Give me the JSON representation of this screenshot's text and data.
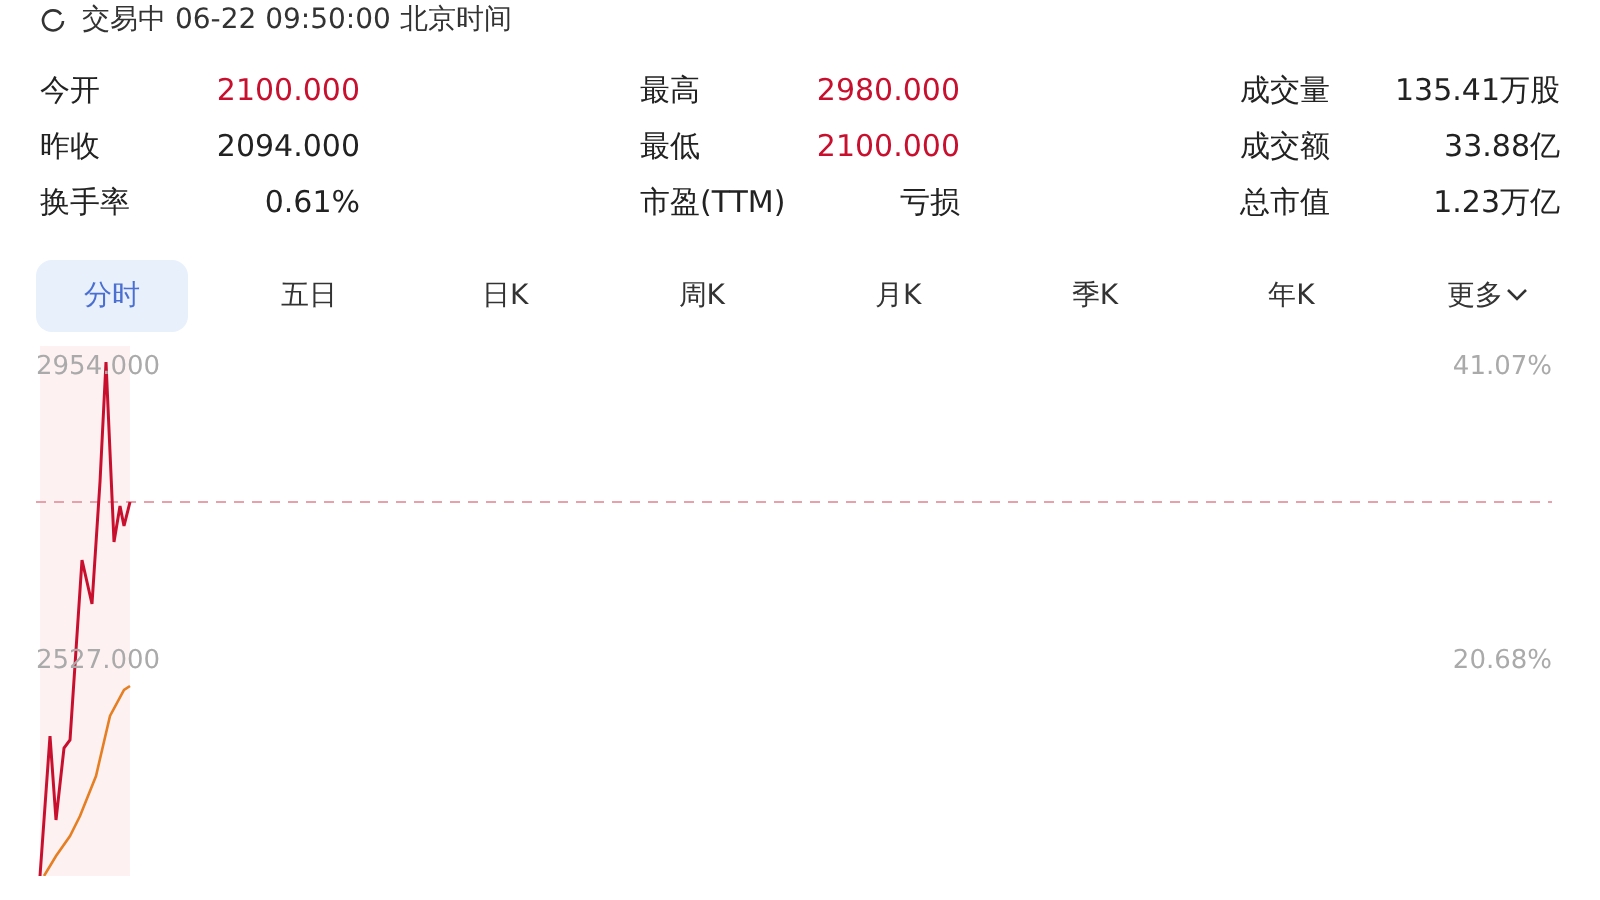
{
  "status": {
    "text": "交易中 06-22 09:50:00 北京时间"
  },
  "stats": [
    {
      "label": "今开",
      "value": "2100.000",
      "color": "#c8102e"
    },
    {
      "label": "最高",
      "value": "2980.000",
      "color": "#c8102e"
    },
    {
      "label": "成交量",
      "value": "135.41万股",
      "color": "#222222"
    },
    {
      "label": "昨收",
      "value": "2094.000",
      "color": "#222222"
    },
    {
      "label": "最低",
      "value": "2100.000",
      "color": "#c8102e"
    },
    {
      "label": "成交额",
      "value": "33.88亿",
      "color": "#222222"
    },
    {
      "label": "换手率",
      "value": "0.61%",
      "color": "#222222"
    },
    {
      "label": "市盈(TTM)",
      "value": "亏损",
      "color": "#222222"
    },
    {
      "label": "总市值",
      "value": "1.23万亿",
      "color": "#222222"
    }
  ],
  "tabs": [
    {
      "label": "分时",
      "selected": true
    },
    {
      "label": "五日",
      "selected": false
    },
    {
      "label": "日K",
      "selected": false
    },
    {
      "label": "周K",
      "selected": false
    },
    {
      "label": "月K",
      "selected": false
    },
    {
      "label": "季K",
      "selected": false
    },
    {
      "label": "年K",
      "selected": false
    },
    {
      "label": "更多",
      "selected": false,
      "dropdown": true
    }
  ],
  "chart": {
    "price_labels": [
      "2954.000",
      "2527.000"
    ],
    "percent_labels": [
      "41.07%",
      "20.68%"
    ]
  }
}
